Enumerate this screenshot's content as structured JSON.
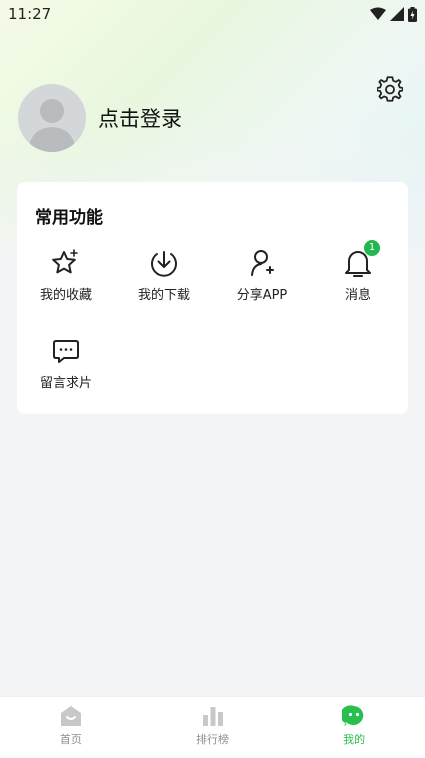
{
  "status": {
    "time": "11:27"
  },
  "profile": {
    "login_label": "点击登录"
  },
  "features": {
    "title": "常用功能",
    "items": [
      {
        "label": "我的收藏",
        "icon": "star-icon"
      },
      {
        "label": "我的下载",
        "icon": "download-icon"
      },
      {
        "label": "分享APP",
        "icon": "add-user-icon"
      },
      {
        "label": "消息",
        "icon": "bell-icon",
        "badge": "1"
      },
      {
        "label": "留言求片",
        "icon": "chat-icon"
      }
    ]
  },
  "tabbar": {
    "items": [
      {
        "label": "首页",
        "icon": "home-icon"
      },
      {
        "label": "排行榜",
        "icon": "bar-chart-icon"
      },
      {
        "label": "我的",
        "icon": "smiley-icon",
        "active": true
      }
    ]
  },
  "colors": {
    "accent": "#27c04e",
    "badge": "#22b84f"
  }
}
